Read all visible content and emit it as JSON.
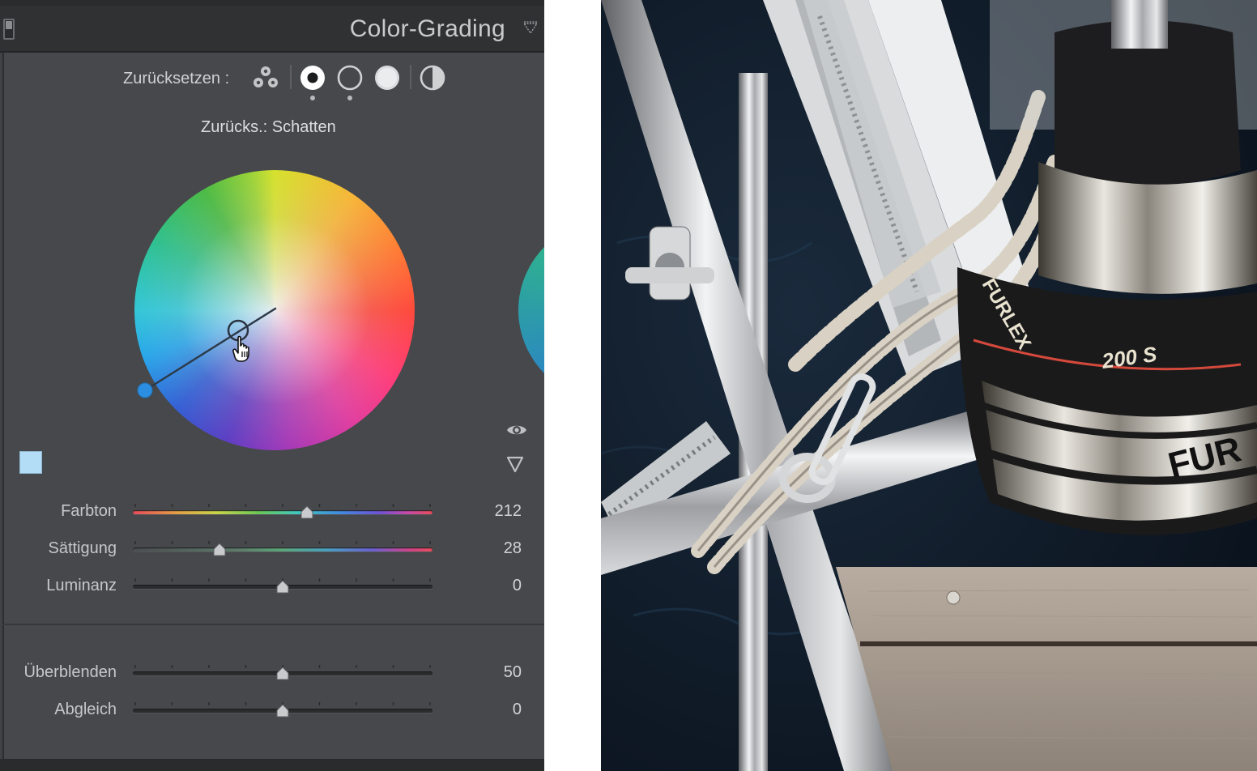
{
  "panel": {
    "title": "Color-Grading",
    "reset_label": "Zurücksetzen :",
    "sub_label": "Zurücks.: Schatten",
    "icons": {
      "header_toggle": "panel-toggle-icon",
      "header_menu": "panel-menu-icon",
      "three_way": "three-way-view-icon",
      "shadows": "shadows-circle-icon",
      "midtones": "midtones-circle-icon",
      "highlights": "highlights-circle-icon",
      "global": "global-circle-icon",
      "eye": "eye-icon",
      "disclosure": "disclosure-triangle-icon"
    },
    "wheel": {
      "hue": 212,
      "saturation": 28,
      "selected_region": "Schatten"
    },
    "swatch_color": "#b3ddf7",
    "sliders": [
      {
        "label": "Farbton",
        "value": "212",
        "position": 0.58,
        "track": "hue"
      },
      {
        "label": "Sättigung",
        "value": "28",
        "position": 0.29,
        "track": "sat"
      },
      {
        "label": "Luminanz",
        "value": "0",
        "position": 0.5,
        "track": "plain"
      }
    ],
    "bottom_sliders": [
      {
        "label": "Überblenden",
        "value": "50",
        "position": 0.5
      },
      {
        "label": "Abgleich",
        "value": "0",
        "position": 0.5
      }
    ]
  },
  "photo": {
    "subject": "sailboat bow with Furlex furler",
    "texts": [
      "FURLEX",
      "200 S",
      "FUR"
    ]
  }
}
